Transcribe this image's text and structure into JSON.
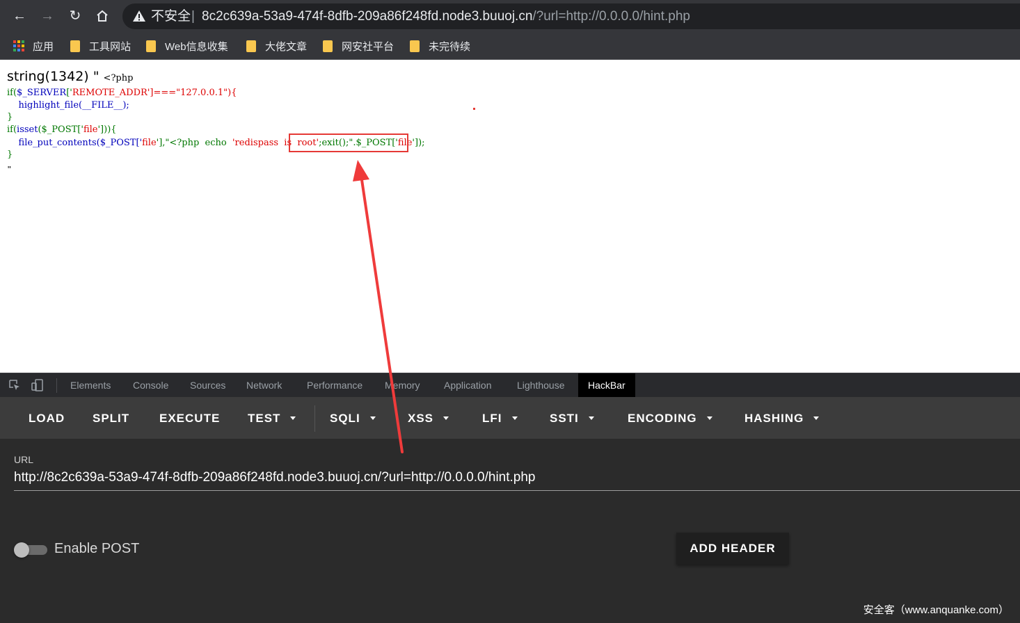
{
  "browser": {
    "security_label": "不安全",
    "separator": "|",
    "url_host": "8c2c639a-53a9-474f-8dfb-209a86f248fd.node3.buuoj.cn",
    "url_path": "/?url=http://0.0.0.0/hint.php"
  },
  "bookmarks": [
    {
      "label": "应用",
      "icon": "apps-grid-icon"
    },
    {
      "label": "工具网站",
      "icon": "folder-icon"
    },
    {
      "label": "Web信息收集",
      "icon": "folder-icon"
    },
    {
      "label": "大佬文章",
      "icon": "folder-icon"
    },
    {
      "label": "网安社平台",
      "icon": "folder-icon"
    },
    {
      "label": "未完待续",
      "icon": "folder-icon"
    }
  ],
  "page": {
    "dump_prefix": "string(1342) \" ",
    "php_open": "<?php",
    "line2_a": "if(",
    "line2_b": "$_SERVER",
    "line2_c": "['",
    "line2_d": "REMOTE_ADDR",
    "line2_e": "']===\"127.0.0.1\"){",
    "line3": "    highlight_file(__FILE__);",
    "line4": "}",
    "line5_a": "if(",
    "line5_b": "isset",
    "line5_c": "($_POST['",
    "line5_d": "file",
    "line5_e": "'])){",
    "line6_a": "    file_put_contents($_POST['",
    "line6_b": "file",
    "line6_c": "'],\"<?php  echo  ",
    "line6_d": "'redispass  is  root'",
    "line6_e": ";exit();\".$_POST['",
    "line6_f": "file",
    "line6_g": "']);",
    "line7": "}",
    "quote_end": "\""
  },
  "devtools": {
    "tabs": [
      "Elements",
      "Console",
      "Sources",
      "Network",
      "Performance",
      "Memory",
      "Application",
      "Lighthouse",
      "HackBar"
    ],
    "active_tab": "HackBar"
  },
  "hackbar": {
    "buttons": [
      "LOAD",
      "SPLIT",
      "EXECUTE",
      "TEST",
      "SQLI",
      "XSS",
      "LFI",
      "SSTI",
      "ENCODING",
      "HASHING"
    ],
    "url_label": "URL",
    "url_value": "http://8c2c639a-53a9-474f-8dfb-209a86f248fd.node3.buuoj.cn/?url=http://0.0.0.0/hint.php",
    "enable_post_label": "Enable POST",
    "enable_post": false,
    "add_header_label": "ADD HEADER"
  },
  "watermark": "安全客（www.anquanke.com）",
  "colors": {
    "chrome_bg": "#35363a",
    "omnibox_bg": "#202124",
    "folder": "#f9c74f",
    "highlight_box": "#e53935",
    "hackbar_bg": "#2b2b2b",
    "hackbar_toolbar": "#3c3c3c"
  }
}
